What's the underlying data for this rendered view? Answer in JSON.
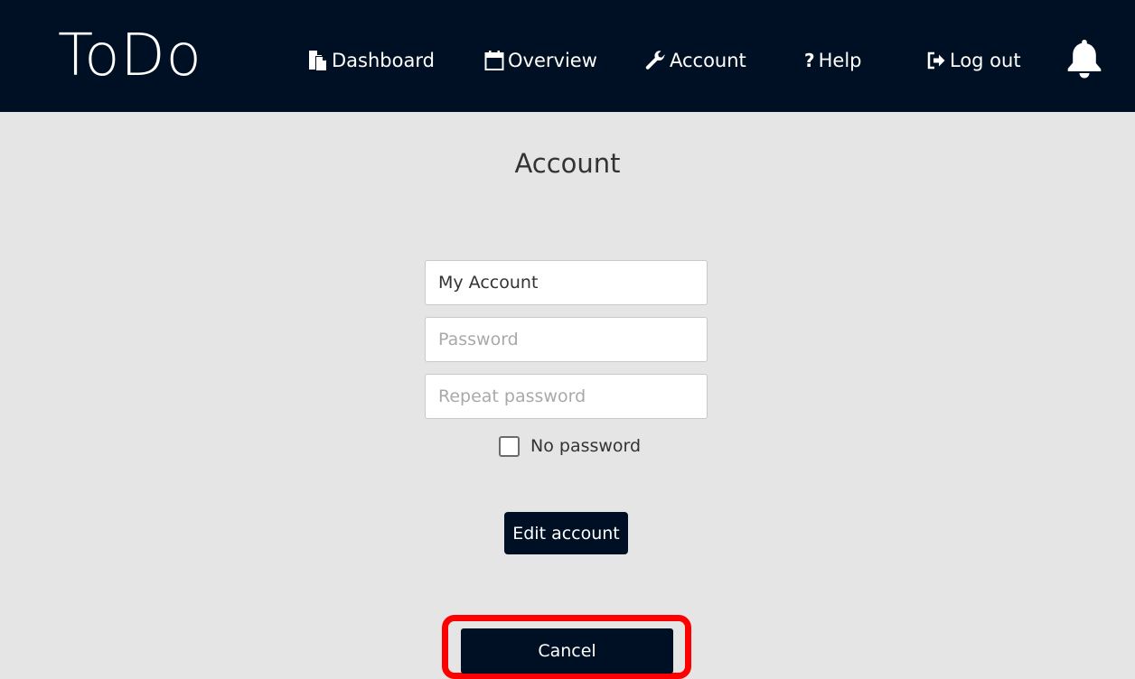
{
  "brand": "ToDo",
  "nav": {
    "dashboard": {
      "label": "Dashboard",
      "icon": "documents-icon"
    },
    "overview": {
      "label": "Overview",
      "icon": "calendar-icon"
    },
    "account": {
      "label": "Account",
      "icon": "wrench-icon"
    },
    "help": {
      "label": "Help",
      "icon": "question-icon"
    },
    "logout": {
      "label": "Log out",
      "icon": "logout-icon"
    },
    "notifications": {
      "icon": "bell-icon"
    }
  },
  "page": {
    "title": "Account"
  },
  "form": {
    "account_name_value": "My Account",
    "password_placeholder": "Password",
    "repeat_password_placeholder": "Repeat password",
    "no_password_label": "No password",
    "no_password_checked": false,
    "edit_button": "Edit account",
    "cancel_button": "Cancel"
  },
  "colors": {
    "navbar": "#001024",
    "page_background": "#e5e5e5",
    "button": "#001024",
    "highlight": "#ff0000"
  }
}
